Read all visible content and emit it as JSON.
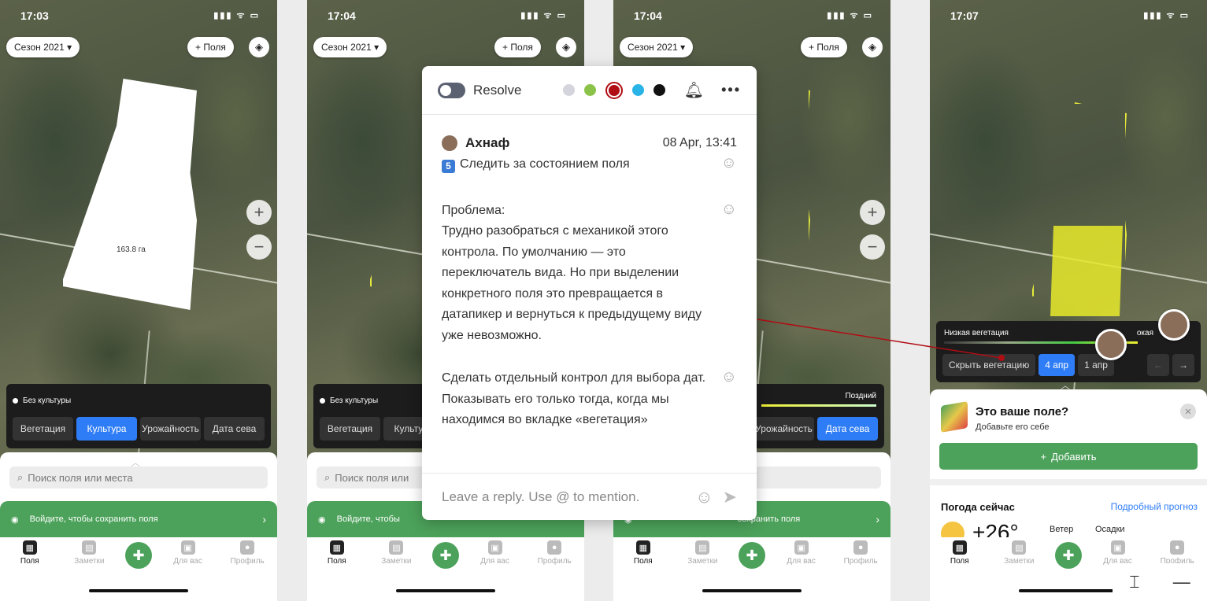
{
  "phones": [
    {
      "time": "17:03",
      "season": "Сезон 2021",
      "fields_btn": "Поля",
      "field_area": "163.8 га",
      "crop_label": "Без культуры",
      "segments": [
        "Вегетация",
        "Культура",
        "Урожайность",
        "Дата сева"
      ],
      "active_segment": 1,
      "search_placeholder": "Поиск поля или места",
      "login_text": "Войдите, чтобы сохранить поля",
      "tabs": [
        "Поля",
        "Заметки",
        "Для вас",
        "Профиль"
      ]
    },
    {
      "time": "17:04",
      "season": "Сезон 2021",
      "fields_btn": "Поля",
      "crop_label": "Без культуры",
      "segments": [
        "Вегетация",
        "Культура"
      ],
      "search_placeholder": "Поиск поля или",
      "login_text": "Войдите, чтобы",
      "tabs": [
        "Поля",
        "Заметки",
        "Для вас",
        "Профиль"
      ]
    },
    {
      "time": "17:04",
      "season": "Сезон 2021",
      "fields_btn": "Поля",
      "legend_right": "Поздний",
      "segments": [
        "Урожайность",
        "Дата сева"
      ],
      "active_segment": 1,
      "login_text": "сохранить поля",
      "tabs": [
        "Поля",
        "Заметки",
        "Для вас",
        "Профиль"
      ]
    },
    {
      "time": "17:07",
      "veg_label": "Низкая вегетация",
      "veg_label_right": "окая",
      "hide_btn": "Скрыть вегетацию",
      "date_active": "4 апр",
      "date_other": "1 апр",
      "card_title": "Это ваше поле?",
      "card_sub": "Добавьте его себе",
      "add_btn": "Добавить",
      "weather_title": "Погода сейчас",
      "weather_link": "Подробный прогноз",
      "temp": "+26°",
      "wind": "Ветер",
      "precip": "Осадки",
      "tabs": [
        "Поля",
        "Заметки",
        "Для вас",
        "Профиль"
      ]
    }
  ],
  "popover": {
    "resolve": "Resolve",
    "colors": [
      "#d4d4dc",
      "#8bc34a",
      "#b00d14",
      "#2ab3e6",
      "#111111"
    ],
    "author": "Ахнаф",
    "date": "08 Apr, 13:41",
    "line1": "Следить за состоянием поля",
    "badge": "5",
    "problem_title": "Проблема:",
    "problem_text": "Трудно разобраться с механикой этого контрола. По умолчанию — это переключатель вида. Но при выделении конкретного поля это превращается в датапикер и вернуться к предыдущему виду уже невозможно.",
    "solution_text": "Сделать отдельный контрол для выбора дат. Показывать его только тогда, когда мы находимся во вкладке «вегетация»",
    "reply_placeholder": "Leave a reply. Use @ to mention."
  },
  "corner_tools": {
    "frame_icon": "⌶",
    "minus_icon": "—"
  }
}
